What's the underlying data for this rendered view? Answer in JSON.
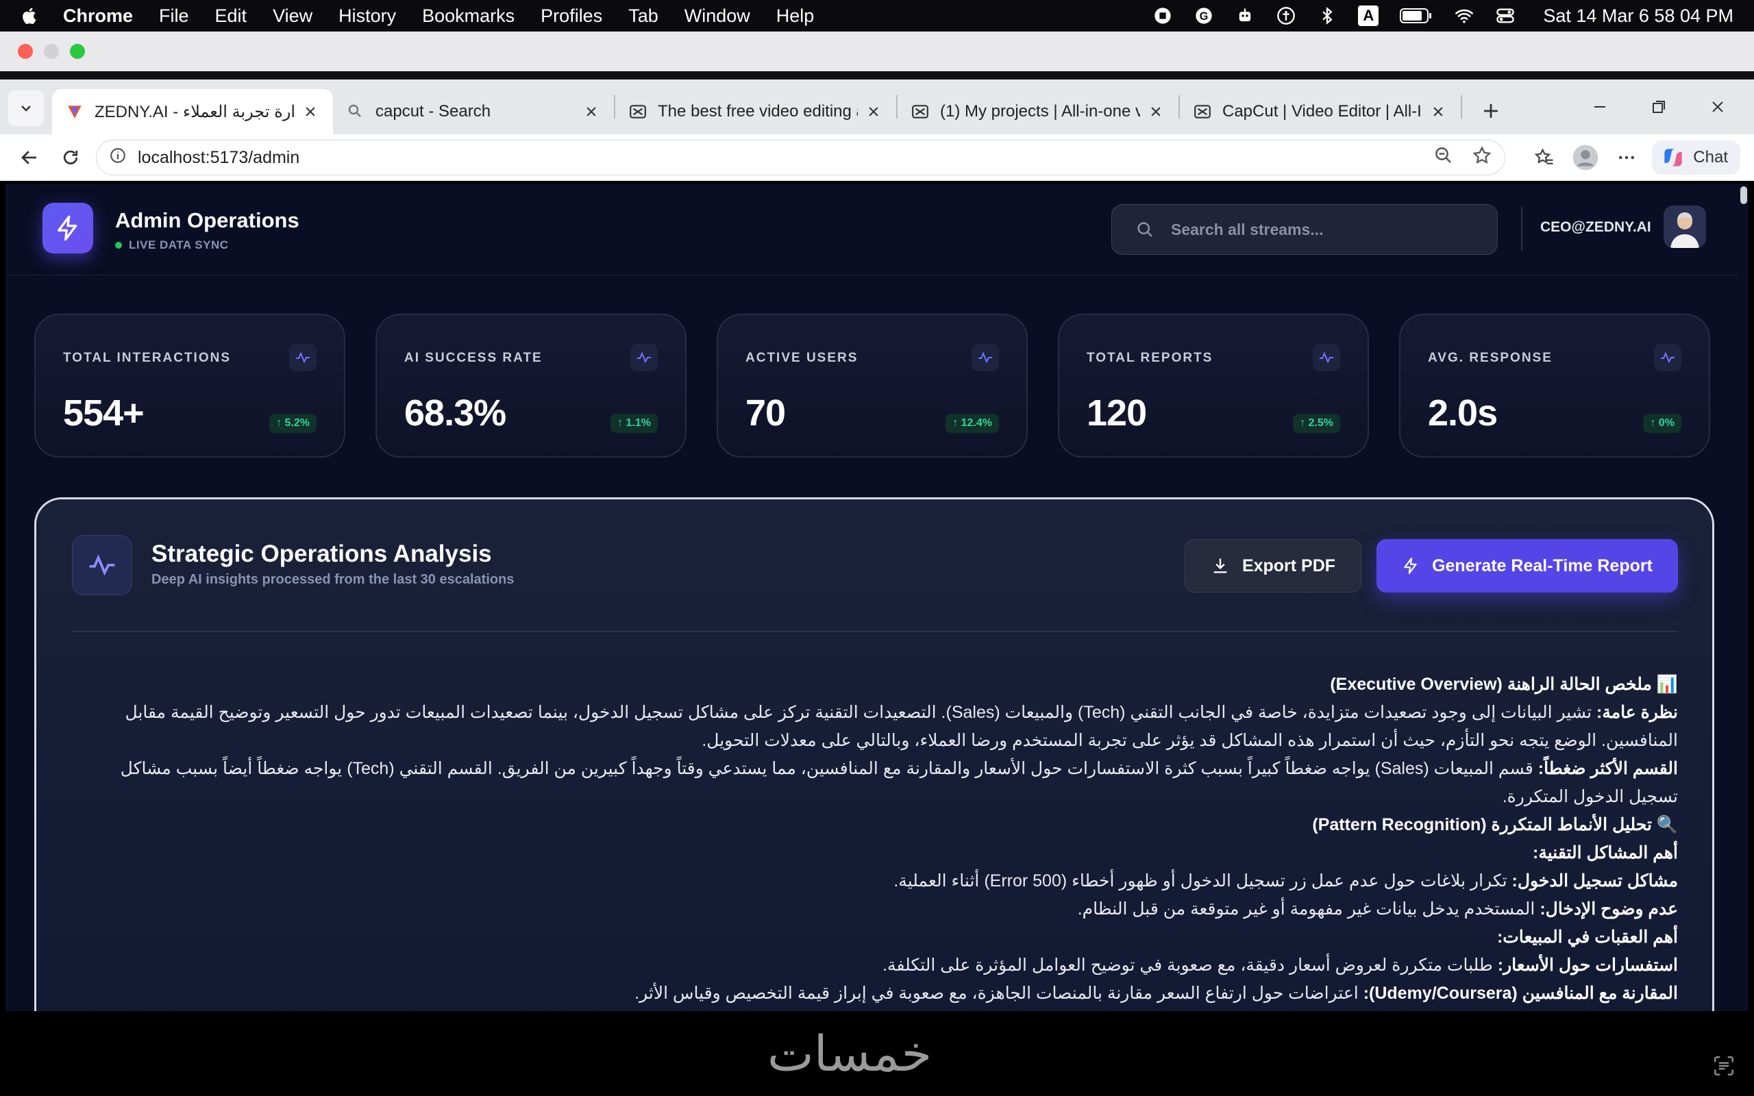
{
  "menubar": {
    "app": "Chrome",
    "items": [
      "File",
      "Edit",
      "View",
      "History",
      "Bookmarks",
      "Profiles",
      "Tab",
      "Window",
      "Help"
    ],
    "clock": "Sat 14 Mar  6 58 04 PM",
    "input_indicator": "A"
  },
  "tabs": [
    {
      "title": "ZEDNY.AI - ـة إدارة تجربة العملاء",
      "icon": "zedny-icon",
      "active": true
    },
    {
      "title": "capcut - Search",
      "icon": "search-icon",
      "active": false
    },
    {
      "title": "The best free video editing app",
      "icon": "capcut-icon",
      "active": false
    },
    {
      "title": "(1)  My projects | All-in-one v",
      "icon": "capcut-icon",
      "active": false
    },
    {
      "title": "CapCut | Video Editor | All-In-O",
      "icon": "capcut-icon",
      "active": false
    }
  ],
  "address": {
    "url": "localhost:5173/admin"
  },
  "toolbar": {
    "chat_label": "Chat"
  },
  "header": {
    "title": "Admin Operations",
    "status": "LIVE DATA SYNC",
    "search_placeholder": "Search all streams...",
    "user": "CEO@ZEDNY.AI"
  },
  "stats": [
    {
      "label": "TOTAL INTERACTIONS",
      "value": "554+",
      "delta": "↑ 5.2%"
    },
    {
      "label": "AI SUCCESS RATE",
      "value": "68.3%",
      "delta": "↑ 1.1%"
    },
    {
      "label": "ACTIVE USERS",
      "value": "70",
      "delta": "↑ 12.4%"
    },
    {
      "label": "TOTAL REPORTS",
      "value": "120",
      "delta": "↑ 2.5%"
    },
    {
      "label": "AVG. RESPONSE",
      "value": "2.0s",
      "delta": "↑ 0%"
    }
  ],
  "panel": {
    "title": "Strategic Operations Analysis",
    "subtitle": "Deep AI insights processed from the last 30 escalations",
    "export_label": "Export PDF",
    "generate_label": "Generate Real-Time Report"
  },
  "report": {
    "h1": "📊 ملخص الحالة الراهنة (Executive Overview)",
    "p1_bold": "نظرة عامة:",
    "p1": " تشير البيانات إلى وجود تصعيدات متزايدة، خاصة في الجانب التقني (Tech) والمبيعات (Sales). التصعيدات التقنية تركز على مشاكل تسجيل الدخول، بينما تصعيدات المبيعات تدور حول التسعير وتوضيح القيمة مقابل المنافسين. الوضع يتجه نحو التأزم، حيث أن استمرار هذه المشاكل قد يؤثر على تجربة المستخدم ورضا العملاء، وبالتالي على معدلات التحويل.",
    "p2_bold": "القسم الأكثر ضغطاً:",
    "p2": " قسم المبيعات (Sales) يواجه ضغطاً كبيراً بسبب كثرة الاستفسارات حول الأسعار والمقارنة مع المنافسين، مما يستدعي وقتاً وجهداً كبيرين من الفريق. القسم التقني (Tech) يواجه ضغطاً أيضاً بسبب مشاكل تسجيل الدخول المتكررة.",
    "h2": "🔍 تحليل الأنماط المتكررة (Pattern Recognition)",
    "h3": "أهم المشاكل التقنية:",
    "p3_bold": "مشاكل تسجيل الدخول:",
    "p3": " تكرار بلاغات حول عدم عمل زر تسجيل الدخول أو ظهور أخطاء (Error 500) أثناء العملية.",
    "p4_bold": "عدم وضوح الإدخال:",
    "p4": " المستخدم يدخل بيانات غير مفهومة أو غير متوقعة من قبل النظام.",
    "h4": "أهم العقبات في المبيعات:",
    "p5_bold": "استفسارات حول الأسعار:",
    "p5": " طلبات متكررة لعروض أسعار دقيقة، مع صعوبة في توضيح العوامل المؤثرة على التكلفة.",
    "p6_bold": "المقارنة مع المنافسين (Udemy/Coursera):",
    "p6": " اعتراضات حول ارتفاع السعر مقارنة بالمنصات الجاهزة، مع صعوبة في إبراز قيمة التخصيص وقياس الأثر."
  },
  "watermark": "خمسات",
  "colors": {
    "accent": "#5645e6",
    "positive": "#34d399",
    "background": "#0a0e24"
  }
}
